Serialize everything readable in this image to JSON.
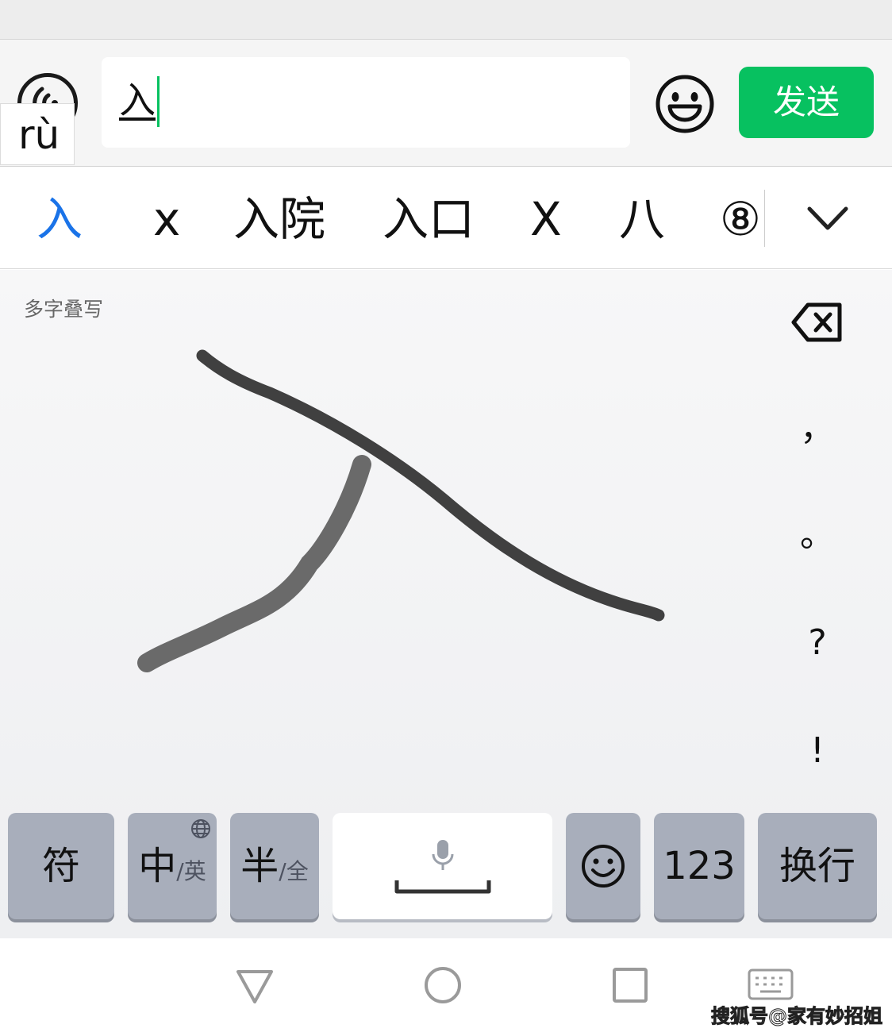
{
  "input_bar": {
    "pinyin": "rù",
    "composing_text": "入",
    "send_label": "发送"
  },
  "candidates": [
    "入",
    "x",
    "入院",
    "入口",
    "X",
    "八",
    "⑧"
  ],
  "handwriting": {
    "mode_label": "多字叠写",
    "punctuation": [
      "，",
      "。",
      "?",
      "!"
    ]
  },
  "keys": {
    "symbol": "符",
    "lang_main": "中",
    "lang_sub": "/英",
    "width_main": "半",
    "width_sub": "/全",
    "numbers": "123",
    "enter": "换行"
  },
  "watermark": "搜狐号@家有妙招姐",
  "colors": {
    "accent_green": "#07c160",
    "active_candidate_blue": "#1a73e8",
    "key_gray": "#a8aebb"
  },
  "icons": [
    "voice-icon",
    "emoji-icon",
    "chevron-down-icon",
    "backspace-icon",
    "globe-icon",
    "microphone-icon",
    "space-bar-icon",
    "smiley-key-icon",
    "nav-back-icon",
    "nav-home-icon",
    "nav-recents-icon",
    "nav-keyboard-icon"
  ]
}
